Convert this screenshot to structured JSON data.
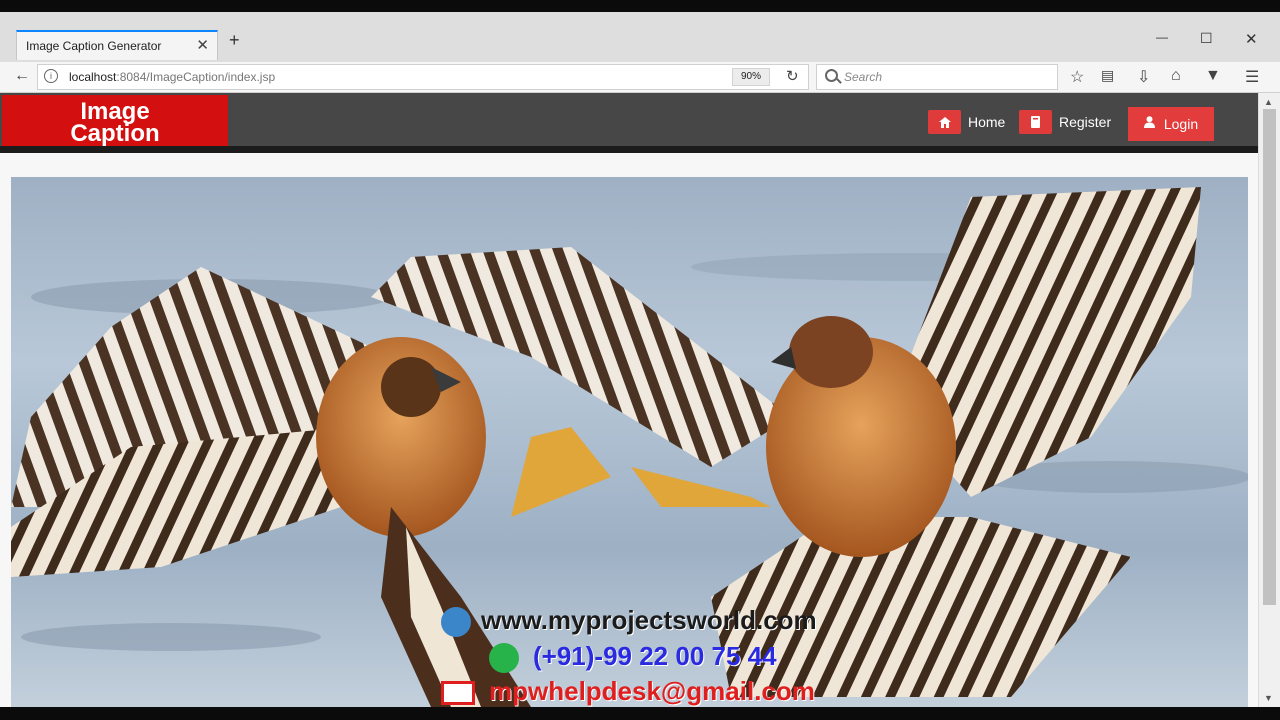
{
  "browser": {
    "tab_title": "Image Caption Generator",
    "tab_close": "✕",
    "new_tab": "+",
    "window_controls": {
      "minimize": "—",
      "maximize": "☐",
      "close": "✕"
    },
    "url_host": "localhost",
    "url_path": ":8084/ImageCaption/index.jsp",
    "zoom": "90%",
    "search_placeholder": "Search",
    "icons": [
      "back-icon",
      "info-icon",
      "reload-icon",
      "search-icon",
      "bookmark-star-icon",
      "reading-list-icon",
      "download-icon",
      "home-icon",
      "pocket-icon",
      "menu-icon"
    ]
  },
  "site": {
    "logo_line1": "Image",
    "logo_line2": "Caption",
    "nav": {
      "home": "Home",
      "register": "Register",
      "login": "Login"
    },
    "colors": {
      "header": "#474747",
      "accent": "#e23c3c",
      "logo": "#d40f0f"
    }
  },
  "hero": {
    "image_alt": "Two hawks fighting in mid-air",
    "watermark_site": "www.myprojectsworld.com",
    "watermark_phone": "(+91)-99 22 00 75 44",
    "watermark_email": "mpwhelpdesk@gmail.com"
  }
}
